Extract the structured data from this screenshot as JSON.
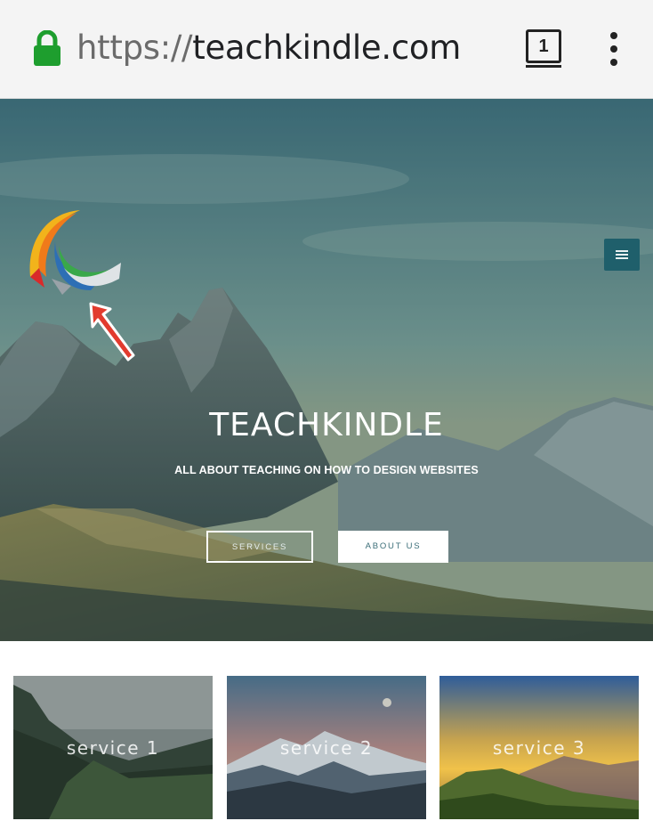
{
  "browser": {
    "url_scheme": "https://",
    "url_host": "teachkindle.com",
    "tab_count": "1",
    "lock_icon": "lock-icon",
    "menu_icon": "more-vert-icon"
  },
  "hero": {
    "title": "TEACHKINDLE",
    "tagline": "ALL ABOUT TEACHING ON HOW TO DESIGN WEBSITES",
    "buttons": {
      "services": "SERVICES",
      "about": "ABOUT US"
    },
    "menu_icon": "hamburger-menu-icon"
  },
  "services": [
    {
      "label": "service 1"
    },
    {
      "label": "service 2"
    },
    {
      "label": "service 3"
    }
  ],
  "colors": {
    "lock_green": "#1e9e2e",
    "hamburger_bg": "#1f5f6b",
    "annotation_arrow": "#e23b2e"
  }
}
